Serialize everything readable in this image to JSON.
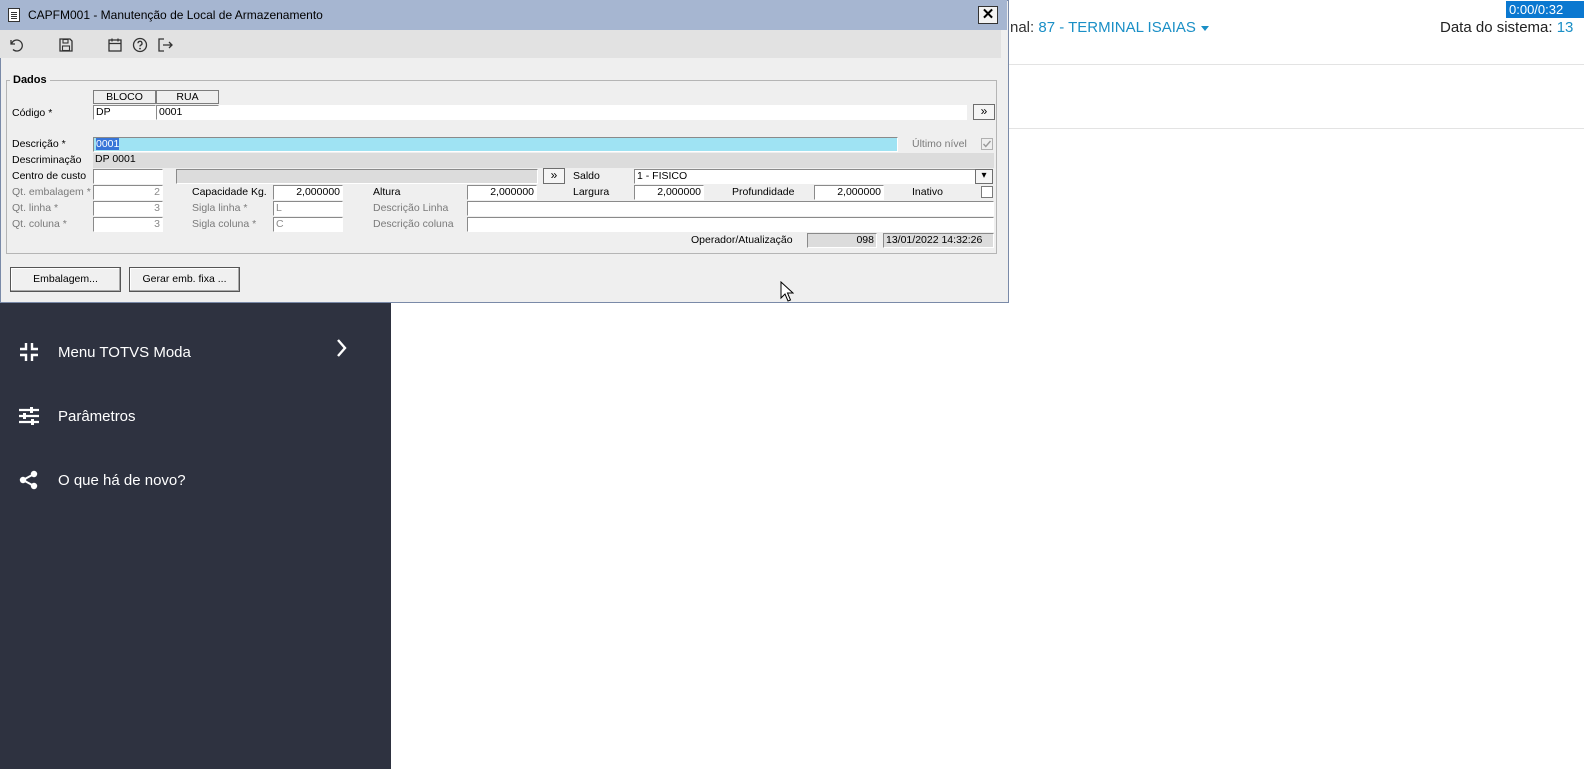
{
  "background": {
    "terminal_prefix": "nal: ",
    "terminal_value": "87 - TERMINAL ISAIAS",
    "sysdate_label": "Data do sistema: ",
    "sysdate_value": "13",
    "timer": "0:00/0:32",
    "accent_color": "#1a8fc6",
    "sidebar": {
      "items": [
        {
          "label": "Menu TOTVS Moda",
          "icon": "collapse-icon"
        },
        {
          "label": "Parâmetros",
          "icon": "sliders-icon"
        },
        {
          "label": "O que há de novo?",
          "icon": "share-icon"
        }
      ]
    }
  },
  "dialog": {
    "title": "CAPFM001 - Manutenção de Local de Armazenamento",
    "close_label": "✕",
    "toolbar": [
      "undo-icon",
      "save-icon",
      "calendar-icon",
      "help-icon",
      "exit-icon"
    ],
    "group_title": "Dados",
    "columns": [
      "BLOCO",
      "RUA"
    ],
    "codigo": {
      "label": "Código *",
      "bloco": "DP",
      "rua": "0001",
      "more": "»"
    },
    "descricao": {
      "label": "Descrição *",
      "value": "0001"
    },
    "ultimo_nivel": {
      "label": "Último nível",
      "checked": true
    },
    "descriminacao": {
      "label": "Descriminação",
      "value": "DP 0001"
    },
    "centro_custo": {
      "label": "Centro de custo",
      "value": "",
      "desc": "",
      "more": "»"
    },
    "saldo": {
      "label": "Saldo",
      "value": "1 - FISICO",
      "dropdown": "▾"
    },
    "qt_embalagem": {
      "label": "Qt. embalagem *",
      "value": "2"
    },
    "capacidade": {
      "label": "Capacidade Kg.",
      "value": "2,000000"
    },
    "altura": {
      "label": "Altura",
      "value": "2,000000"
    },
    "largura": {
      "label": "Largura",
      "value": "2,000000"
    },
    "profundidade": {
      "label": "Profundidade",
      "value": "2,000000"
    },
    "inativo": {
      "label": "Inativo",
      "checked": false
    },
    "qt_linha": {
      "label": "Qt. linha *",
      "value": "3"
    },
    "sigla_linha": {
      "label": "Sigla linha *",
      "value": "L"
    },
    "descricao_linha": {
      "label": "Descrição Linha",
      "value": ""
    },
    "qt_coluna": {
      "label": "Qt. coluna *",
      "value": "3"
    },
    "sigla_coluna": {
      "label": "Sigla coluna *",
      "value": "C"
    },
    "descricao_coluna": {
      "label": "Descrição coluna",
      "value": ""
    },
    "operador": {
      "label": "Operador/Atualização",
      "code": "098",
      "datetime": "13/01/2022 14:32:26"
    },
    "buttons": {
      "embalagem": "Embalagem...",
      "gerar": "Gerar emb. fixa ..."
    }
  }
}
